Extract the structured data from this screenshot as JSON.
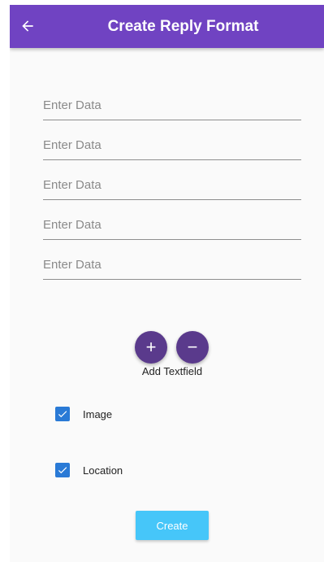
{
  "appbar": {
    "title": "Create Reply Format",
    "back_icon": "arrow-left-icon",
    "color": "#7043c2"
  },
  "fields": [
    {
      "placeholder": "Enter Data",
      "value": ""
    },
    {
      "placeholder": "Enter Data",
      "value": ""
    },
    {
      "placeholder": "Enter Data",
      "value": ""
    },
    {
      "placeholder": "Enter Data",
      "value": ""
    },
    {
      "placeholder": "Enter Data",
      "value": ""
    }
  ],
  "textfield_controls": {
    "add_icon": "plus-icon",
    "remove_icon": "minus-icon",
    "add_symbol": "+",
    "remove_symbol": "−",
    "label": "Add Textfield",
    "color": "#5a3a8c"
  },
  "options": [
    {
      "label": "Image",
      "checked": true
    },
    {
      "label": "Location",
      "checked": true
    }
  ],
  "create_button": {
    "label": "Create",
    "color": "#46c6f9"
  }
}
